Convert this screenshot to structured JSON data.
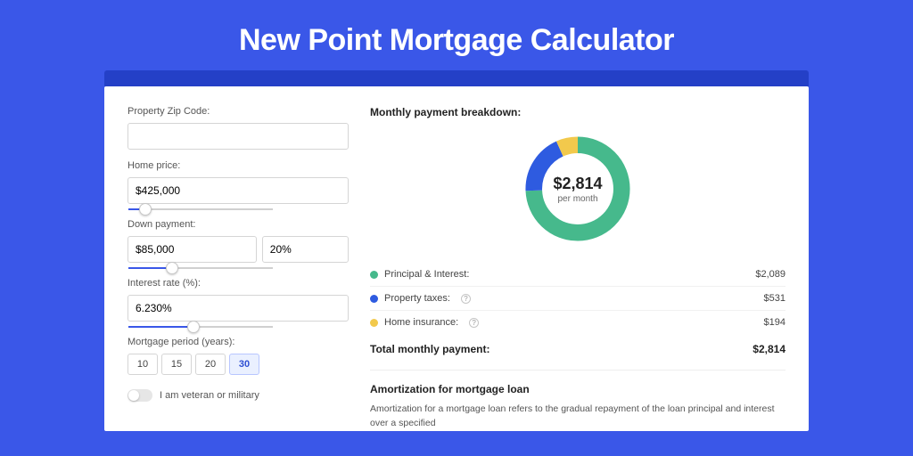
{
  "title": "New Point Mortgage Calculator",
  "form": {
    "zip_label": "Property Zip Code:",
    "zip_value": "",
    "home_price_label": "Home price:",
    "home_price_value": "$425,000",
    "down_payment_label": "Down payment:",
    "down_payment_value": "$85,000",
    "down_payment_percent": "20%",
    "interest_label": "Interest rate (%):",
    "interest_value": "6.230%",
    "period_label": "Mortgage period (years):",
    "period_options": [
      "10",
      "15",
      "20",
      "30"
    ],
    "period_selected": "30",
    "veteran_label": "I am veteran or military"
  },
  "breakdown": {
    "section_title": "Monthly payment breakdown:",
    "center_value": "$2,814",
    "center_sub": "per month",
    "items": [
      {
        "label": "Principal & Interest:",
        "value": "$2,089",
        "color": "#46b98c",
        "info": false
      },
      {
        "label": "Property taxes:",
        "value": "$531",
        "color": "#2e5be0",
        "info": true
      },
      {
        "label": "Home insurance:",
        "value": "$194",
        "color": "#f2c94c",
        "info": true
      }
    ],
    "total_label": "Total monthly payment:",
    "total_value": "$2,814"
  },
  "amortization": {
    "title": "Amortization for mortgage loan",
    "text": "Amortization for a mortgage loan refers to the gradual repayment of the loan principal and interest over a specified"
  },
  "chart_data": {
    "type": "pie",
    "title": "Monthly payment breakdown",
    "categories": [
      "Principal & Interest",
      "Property taxes",
      "Home insurance"
    ],
    "values": [
      2089,
      531,
      194
    ],
    "colors": [
      "#46b98c",
      "#2e5be0",
      "#f2c94c"
    ],
    "total": 2814,
    "donut": true,
    "center_label": "$2,814 per month"
  }
}
